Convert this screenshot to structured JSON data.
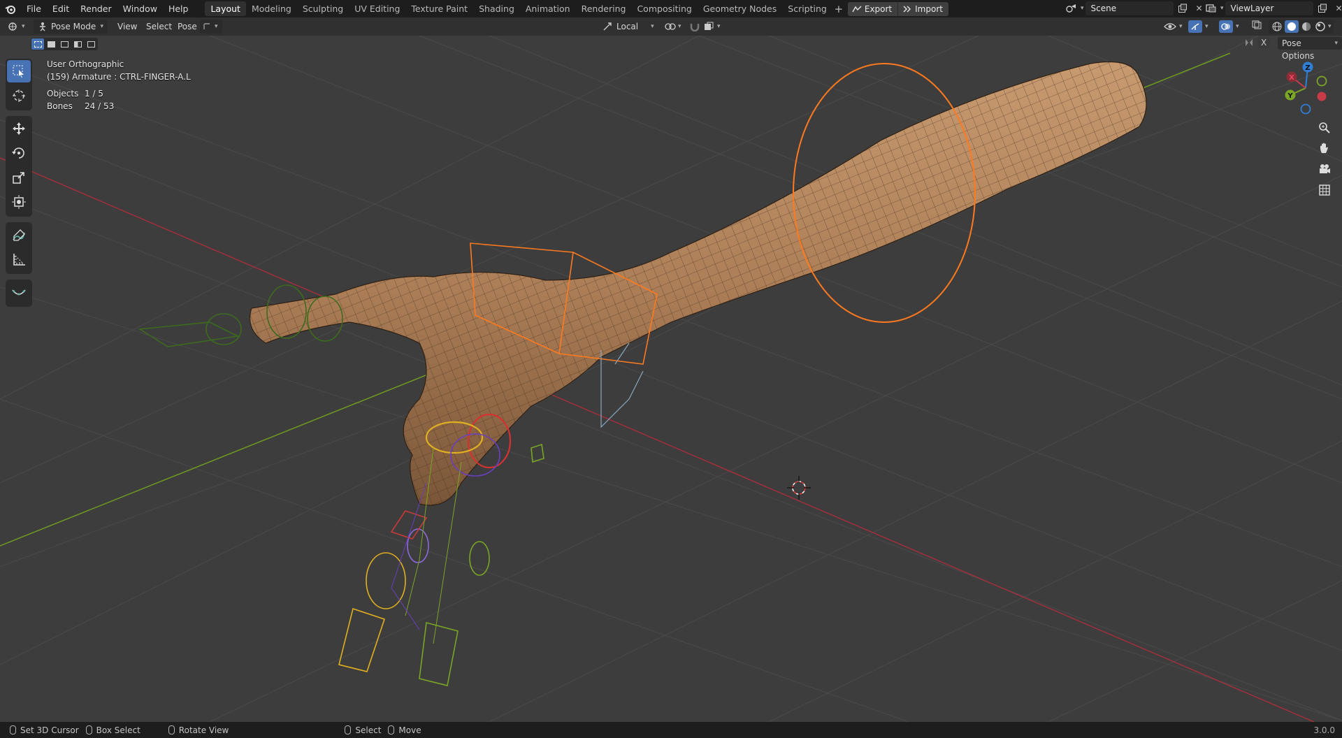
{
  "menu": {
    "items": [
      "File",
      "Edit",
      "Render",
      "Window",
      "Help"
    ]
  },
  "workspaces": {
    "tabs": [
      "Layout",
      "Modeling",
      "Sculpting",
      "UV Editing",
      "Texture Paint",
      "Shading",
      "Animation",
      "Rendering",
      "Compositing",
      "Geometry Nodes",
      "Scripting"
    ],
    "add_label": "+"
  },
  "export_import": {
    "export": "Export",
    "import": "Import"
  },
  "scene": {
    "name": "Scene"
  },
  "view_layer": {
    "name": "ViewLayer"
  },
  "header": {
    "mode": "Pose Mode",
    "view": "View",
    "select": "Select",
    "pose": "Pose",
    "transform_orientation": "Local",
    "pose_options": "Pose Options",
    "x_mirror": "X"
  },
  "viewport_info": {
    "view_name": "User Orthographic",
    "active": "(159) Armature : CTRL-FINGER-A.L",
    "objects_label": "Objects",
    "objects_value": "1 / 5",
    "bones_label": "Bones",
    "bones_value": "24 / 53"
  },
  "gizmo": {
    "x": "X",
    "y": "Y",
    "z": "Z"
  },
  "statusbar": {
    "set_cursor": "Set 3D Cursor",
    "box_select": "Box Select",
    "rotate_view": "Rotate View",
    "select": "Select",
    "move": "Move",
    "version": "3.0.0"
  },
  "colors": {
    "accent_blue": "#4772b3",
    "axis_x": "#c73a48",
    "axis_y": "#7aa525",
    "axis_z": "#2f7fd6",
    "bone_selected": "#ff7a1f",
    "skin": "#b98a62"
  },
  "icons": {
    "tools": [
      "select-box-icon",
      "cursor-icon",
      "move-icon",
      "rotate-icon",
      "scale-icon",
      "transform-icon",
      "annotate-icon",
      "measure-icon",
      "bone-relax-icon"
    ],
    "nav": [
      "zoom-icon",
      "pan-hand-icon",
      "camera-icon",
      "grid-icon"
    ]
  }
}
